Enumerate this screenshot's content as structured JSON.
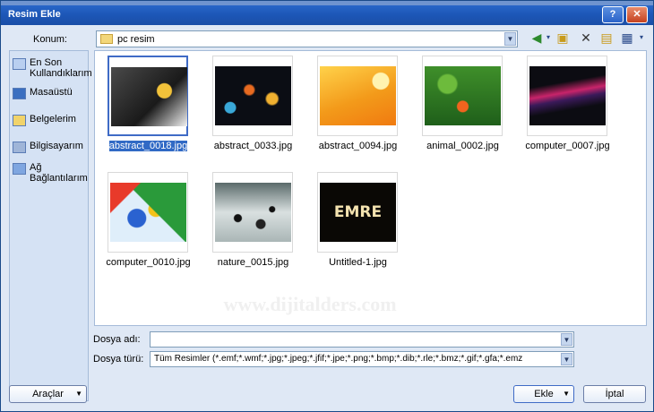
{
  "window": {
    "title": "Resim Ekle",
    "help_label": "?",
    "close_label": "✕"
  },
  "location": {
    "label": "Konum:",
    "value": "pc resim"
  },
  "toolbar": {
    "icons": [
      "back-icon",
      "up-folder-icon",
      "delete-icon",
      "new-folder-icon",
      "views-icon"
    ]
  },
  "places": [
    {
      "label": "En Son Kullandıklarım",
      "icon": "recent-icon"
    },
    {
      "label": "Masaüstü",
      "icon": "desktop-icon"
    },
    {
      "label": "Belgelerim",
      "icon": "documents-icon"
    },
    {
      "label": "Bilgisayarım",
      "icon": "computer-icon"
    },
    {
      "label": "Ağ Bağlantılarım",
      "icon": "network-icon"
    }
  ],
  "files": [
    {
      "name": "abstract_0018.jpg",
      "selected": true
    },
    {
      "name": "abstract_0033.jpg"
    },
    {
      "name": "abstract_0094.jpg"
    },
    {
      "name": "animal_0002.jpg"
    },
    {
      "name": "computer_0007.jpg"
    },
    {
      "name": "computer_0010.jpg"
    },
    {
      "name": "nature_0015.jpg"
    },
    {
      "name": "Untitled-1.jpg",
      "thumb_text": "EMRE"
    }
  ],
  "filename": {
    "label": "Dosya adı:",
    "value": ""
  },
  "filetype": {
    "label": "Dosya türü:",
    "value": "Tüm Resimler (*.emf;*.wmf;*.jpg;*.jpeg;*.jfif;*.jpe;*.png;*.bmp;*.dib;*.rle;*.bmz;*.gif;*.gfa;*.emz"
  },
  "buttons": {
    "tools": "Araçlar",
    "insert": "Ekle",
    "cancel": "İptal"
  },
  "watermark": "www.dijitalders.com",
  "colors": {
    "titlebar": "#1d57b8",
    "selection": "#316ac5",
    "dialog_bg": "#dfe8f5"
  }
}
